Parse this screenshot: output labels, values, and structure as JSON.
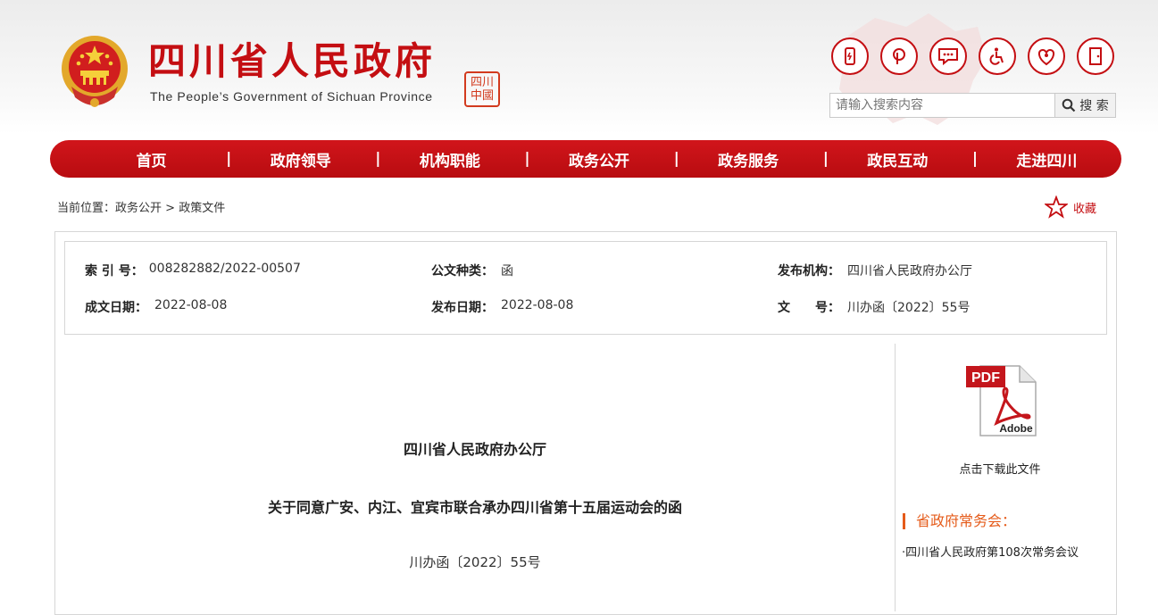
{
  "header": {
    "title": "四川省人民政府",
    "subtitle": "The People’s Government of Sichuan Province",
    "seal_text": "四川中國",
    "icons": [
      "mobile-icon",
      "weibo-icon",
      "message-icon",
      "accessibility-icon",
      "elder-care-icon",
      "exit-icon"
    ],
    "search": {
      "placeholder": "请输入搜索内容",
      "button_label": "搜 索"
    }
  },
  "nav": {
    "items": [
      "首页",
      "政府领导",
      "机构职能",
      "政务公开",
      "政务服务",
      "政民互动",
      "走进四川"
    ],
    "separator": "|"
  },
  "breadcrumb": {
    "prefix": "当前位置：",
    "items": [
      "政务公开",
      "政策文件"
    ],
    "separator": " > "
  },
  "favorite": {
    "label": "收藏"
  },
  "meta": {
    "index_label": "索 引 号：",
    "index_value": "008282882/2022-00507",
    "type_label": "公文种类：",
    "type_value": "函",
    "publisher_label": "发布机构：",
    "publisher_value": "四川省人民政府办公厅",
    "created_label": "成文日期：",
    "created_value": "2022-08-08",
    "published_label": "发布日期：",
    "published_value": "2022-08-08",
    "docnum_label": "文　　号：",
    "docnum_value": "川办函〔2022〕55号"
  },
  "document": {
    "issuer": "四川省人民政府办公厅",
    "title": "关于同意广安、内江、宜宾市联合承办四川省第十五届运动会的函",
    "doc_number": "川办函〔2022〕55号"
  },
  "sidebar": {
    "pdf_badge": "PDF",
    "pdf_brand": "Adobe",
    "download_label": "点击下载此文件",
    "meeting_heading": "省政府常务会：",
    "meeting_link": "·四川省人民政府第108次常务会议"
  },
  "colors": {
    "brand_red": "#c40e12",
    "accent_orange": "#e55b1a"
  }
}
